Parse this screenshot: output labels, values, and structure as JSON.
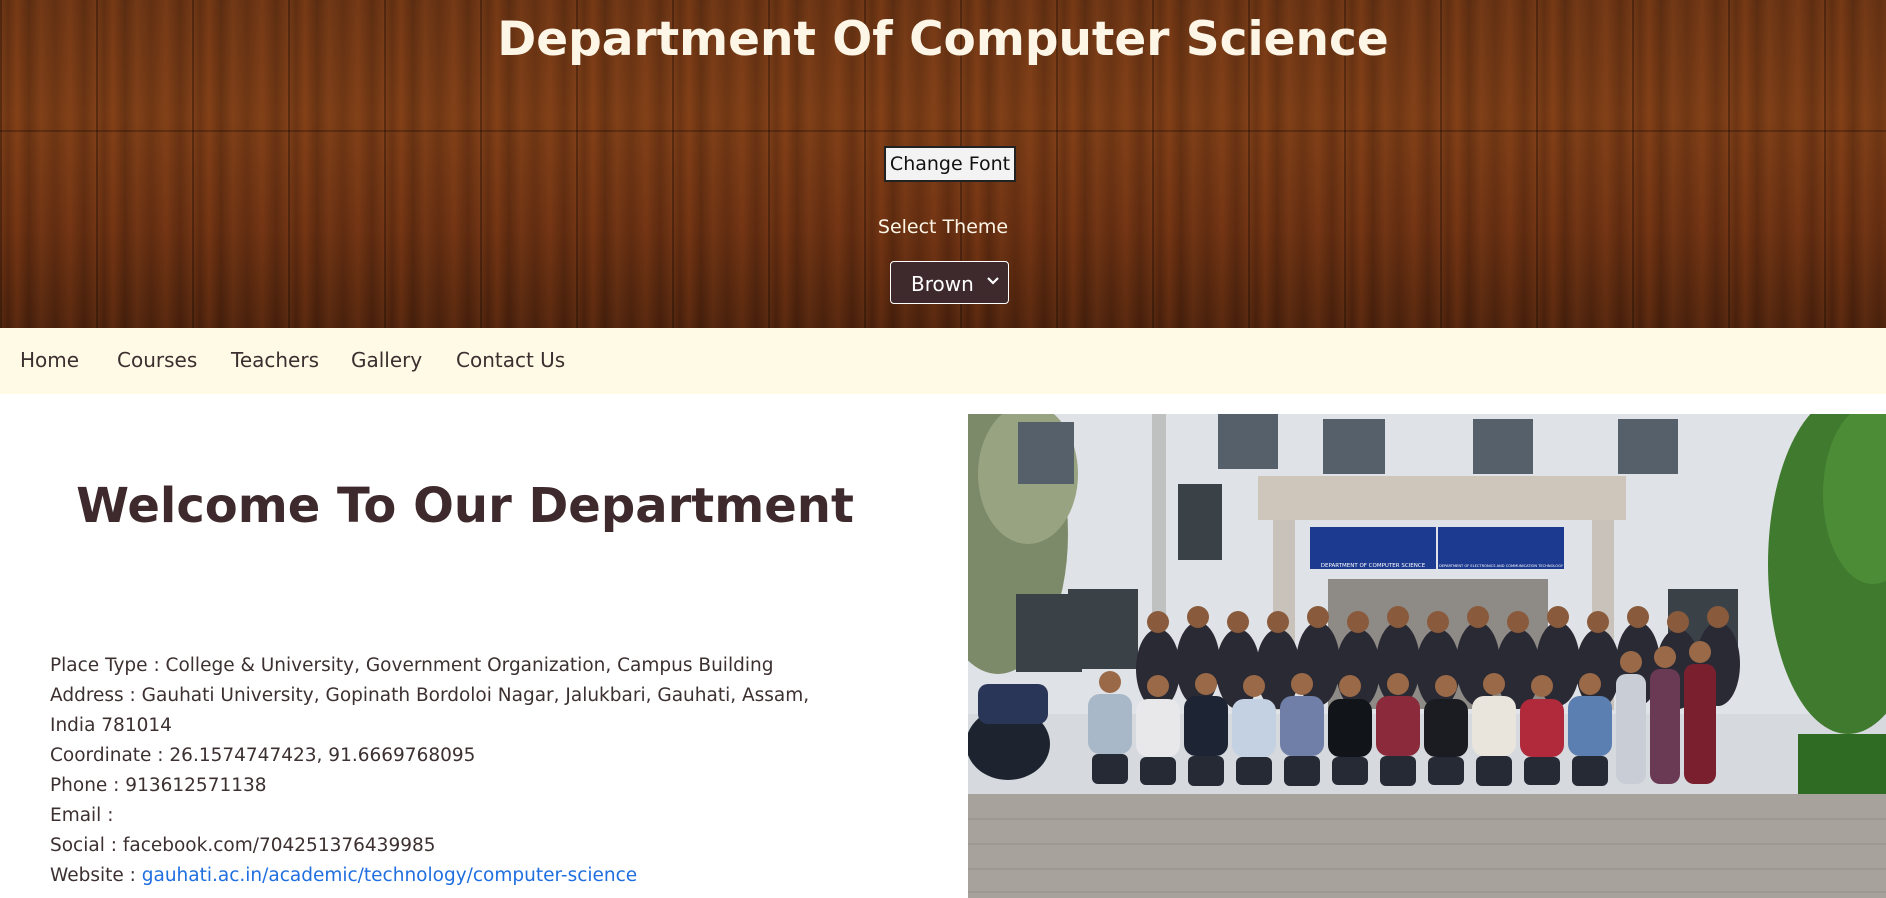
{
  "header": {
    "title": "Department Of Computer Science",
    "change_font_label": "Change Font",
    "theme_label": "Select Theme",
    "theme_selected": "Brown"
  },
  "nav": {
    "items": [
      {
        "label": "Home"
      },
      {
        "label": "Courses"
      },
      {
        "label": "Teachers"
      },
      {
        "label": "Gallery"
      },
      {
        "label": "Contact Us"
      }
    ]
  },
  "main": {
    "welcome_title": "Welcome To Our Department",
    "info": {
      "place_type": "Place Type : College & University, Government Organization, Campus Building",
      "address": "Address : Gauhati University, Gopinath Bordoloi Nagar, Jalukbari, Gauhati, Assam, India 781014",
      "coordinate": "Coordinate : 26.1574747423, 91.6669768095",
      "phone": "Phone : 913612571138",
      "email": "Email :",
      "social": "Social : facebook.com/704251376439985",
      "website_prefix": "Website : ",
      "website_link": "gauhati.ac.in/academic/technology/computer-science"
    },
    "photo": {
      "sign_left": "DEPARTMENT OF COMPUTER SCIENCE",
      "sign_right": "DEPARTMENT OF ELECTRONICS AND COMMUNICATION TECHNOLOGY"
    }
  },
  "colors": {
    "header_text": "#fdf6e6",
    "nav_bg": "#fefae6",
    "heading": "#3e2a2c",
    "link": "#1f6fe0",
    "select_bg": "#3e2a2c"
  }
}
